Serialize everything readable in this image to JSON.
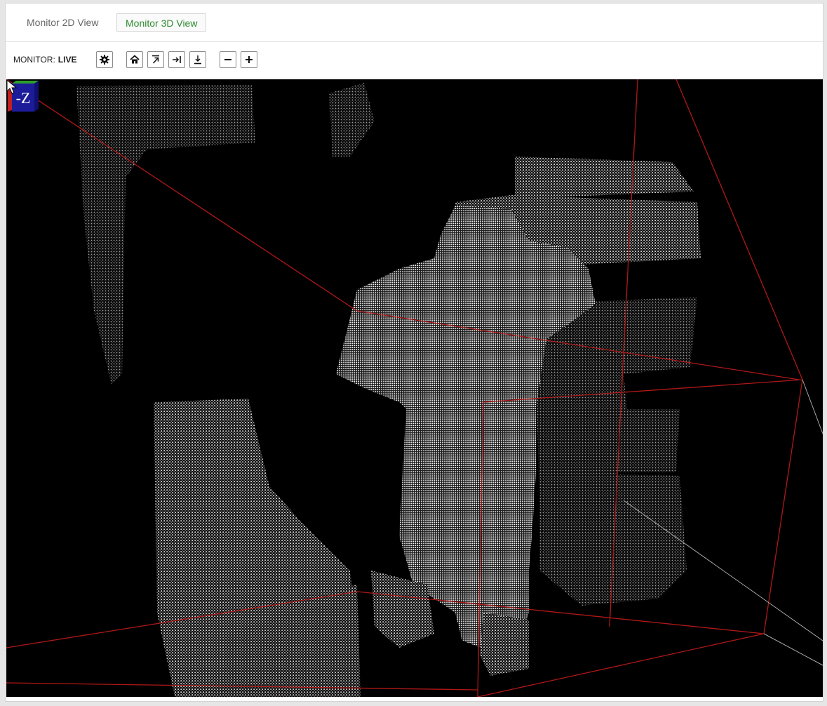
{
  "tabs": [
    {
      "label": "Monitor 2D View",
      "active": false
    },
    {
      "label": "Monitor 3D View",
      "active": true
    }
  ],
  "toolbar": {
    "monitor_prefix": "MONITOR:",
    "monitor_state": "LIVE",
    "buttons": [
      {
        "name": "settings",
        "icon": "gear-icon"
      },
      {
        "name": "home-view",
        "icon": "home-icon"
      },
      {
        "name": "top-view",
        "icon": "arrow-to-top-icon"
      },
      {
        "name": "side-view",
        "icon": "arrow-to-right-icon"
      },
      {
        "name": "front-view",
        "icon": "download-arrow-icon"
      },
      {
        "name": "zoom-out",
        "icon": "minus-icon"
      },
      {
        "name": "zoom-in",
        "icon": "plus-icon"
      }
    ]
  },
  "viewport": {
    "axis_label": "-Z",
    "background_color": "#000000",
    "bounding_box_color": "#b01818",
    "point_color": "#d9d9d9"
  },
  "colors": {
    "active_tab_text": "#2e8b2e",
    "inactive_tab_text": "#666666"
  }
}
